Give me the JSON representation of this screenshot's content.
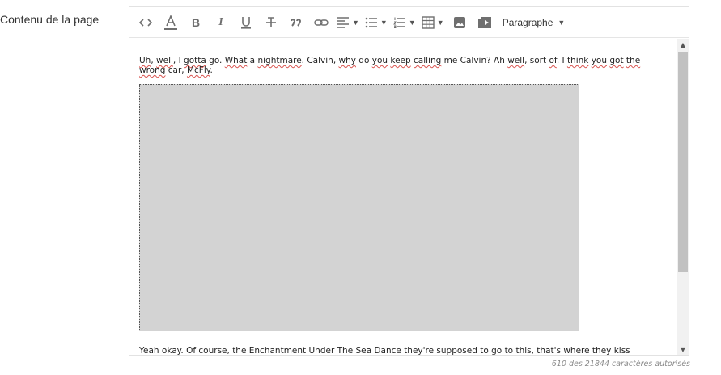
{
  "field": {
    "label": "Contenu de la page"
  },
  "toolbar": {
    "items": [
      {
        "icon": "code-icon"
      },
      {
        "icon": "text-color-icon"
      },
      {
        "icon": "bold-icon",
        "label": "B"
      },
      {
        "icon": "italic-icon",
        "label": "I"
      },
      {
        "icon": "underline-icon"
      },
      {
        "icon": "strikethrough-icon"
      },
      {
        "icon": "blockquote-icon"
      },
      {
        "icon": "link-icon"
      },
      {
        "icon": "align-left-icon"
      },
      {
        "icon": "bulleted-list-icon"
      },
      {
        "icon": "numbered-list-icon"
      },
      {
        "icon": "table-icon"
      },
      {
        "icon": "image-icon"
      },
      {
        "icon": "media-icon"
      }
    ],
    "heading_select": {
      "value": "Paragraphe"
    }
  },
  "content": {
    "paragraph1_segments": [
      "Uh",
      ", ",
      "well",
      ", I ",
      "gotta",
      " go. ",
      "What",
      " a ",
      "nightmare",
      ". Calvin, ",
      "why",
      " do ",
      "you",
      " ",
      "keep",
      " ",
      "calling",
      " me Calvin? Ah ",
      "well",
      ", sort ",
      "of",
      ". I ",
      "think",
      " ",
      "you",
      " ",
      "got",
      " ",
      "the",
      " ",
      "wrong",
      " car, ",
      "McFly",
      "."
    ],
    "paragraph2_segments": [
      "Yeah",
      " ",
      "okay",
      ". ",
      "Of",
      " course, ",
      "the",
      " ",
      "Enchantment",
      " ",
      "Under",
      " ",
      "The",
      " ",
      "Sea",
      " ",
      "Dance",
      " ",
      "they're",
      " ",
      "supposed",
      " ",
      "to",
      " go ",
      "to",
      " this, ",
      "that's",
      " ",
      "where",
      " ",
      "they",
      " ",
      "kiss"
    ]
  },
  "char_count": "610 des 21844 caractères autorisés"
}
